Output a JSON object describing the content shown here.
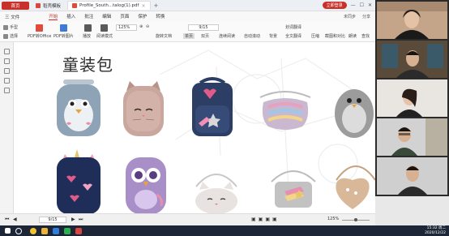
{
  "titlebar": {
    "home_tab": "首页",
    "tabs": [
      {
        "label": "稻壳模板",
        "icon_color": "#d9463e"
      },
      {
        "label": "Profile_South...talog(1).pdf",
        "icon_color": "#e04b3a"
      }
    ],
    "login_label": "立即登录"
  },
  "menubar": {
    "file_label": "三 文件",
    "items": [
      "开始",
      "插入",
      "批注",
      "编辑",
      "页面",
      "保护",
      "转换"
    ],
    "active": "开始",
    "right_items": [
      "未同步",
      "分享"
    ]
  },
  "toolbar": {
    "hand_label": "手型",
    "select_label": "选择",
    "pdf_to_office": "PDF转Office",
    "pdf_to_image": "PDF转图片",
    "play": "播放",
    "read_mode": "阅读模式",
    "zoom_value": "125%",
    "page_value": "9",
    "page_total": "/15",
    "rotate_label": "旋转文档",
    "single_page": "单页",
    "double_page": "双页",
    "continuous": "连续阅读",
    "auto_scroll": "自动滚动",
    "background": "背景",
    "word_translate": "划词翻译",
    "full_translate": "全文翻译",
    "compress": "压缩",
    "screenshot_compare": "截图和对比",
    "read_aloud": "朗读",
    "search": "查找"
  },
  "document": {
    "title": "童装包",
    "products": [
      {
        "name": "penguin-backpack",
        "color": "#8ea3b5"
      },
      {
        "name": "sequin-cat-backpack",
        "color": "#c9a79e"
      },
      {
        "name": "heart-star-backpack",
        "color": "#2c3e64"
      },
      {
        "name": "rainbow-sequin-waist-bag",
        "color": "#c9b8cf"
      },
      {
        "name": "fluffy-penguin-bag",
        "color": "#9c9c9c"
      },
      {
        "name": "unicorn-navy-backpack",
        "color": "#1f2e58"
      },
      {
        "name": "owl-backpack",
        "color": "#a88fc8"
      },
      {
        "name": "white-cat-crossbody",
        "color": "#e8e3e0"
      },
      {
        "name": "rainbow-star-crossbody",
        "color": "#c2c2c2"
      },
      {
        "name": "heart-crossbody",
        "color": "#d9b899"
      }
    ]
  },
  "statusbar": {
    "page": "9",
    "page_total": "/15",
    "zoom": "125%",
    "zoom_fraction": 0.5
  },
  "participants": [
    {
      "name": "participant-1",
      "bg": "#c4a58a",
      "shirt": "#1a1a1a"
    },
    {
      "name": "participant-2",
      "bg": "#5a4a3a",
      "shirt": "#2b2b2b"
    },
    {
      "name": "participant-3",
      "bg": "#e9e6e2",
      "shirt": "#222"
    },
    {
      "name": "participant-4",
      "bg": "#d2d2d2",
      "shirt": "#3a4a3a"
    },
    {
      "name": "participant-5",
      "bg": "#cfcfcf",
      "shirt": "#2a2a2a"
    }
  ],
  "taskbar": {
    "time": "15:32 周二",
    "date": "2020/12/22",
    "icons": [
      {
        "name": "start-icon",
        "color": "#ffffff"
      },
      {
        "name": "search-icon",
        "color": "#ffffff"
      },
      {
        "name": "chrome-icon",
        "color": "#f2c230"
      },
      {
        "name": "folder-icon",
        "color": "#f0b434"
      },
      {
        "name": "tencent-meeting-icon",
        "color": "#2e7de0"
      },
      {
        "name": "wechat-icon",
        "color": "#2bb24c"
      },
      {
        "name": "wps-icon",
        "color": "#d9463e"
      }
    ]
  },
  "colors": {
    "accent": "#c8302b"
  }
}
